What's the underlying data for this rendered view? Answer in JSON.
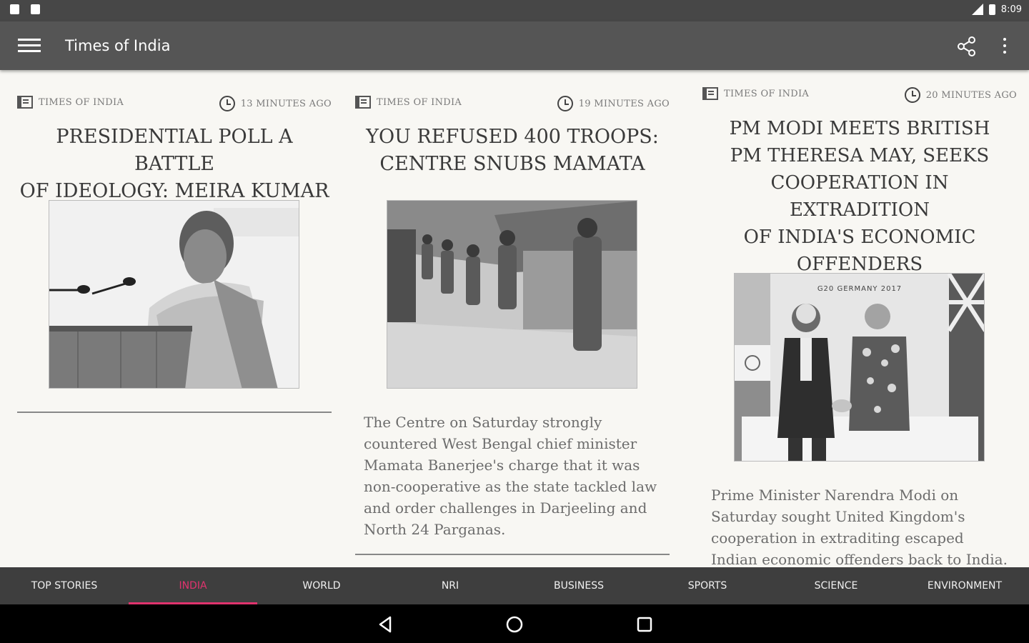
{
  "status_bar": {
    "time": "8:09"
  },
  "app_bar": {
    "title": "Times of India"
  },
  "cards": [
    {
      "source": "TIMES OF INDIA",
      "time": "13 MINUTES AGO",
      "headline_lines": [
        "PRESIDENTIAL POLL A BATTLE",
        "OF IDEOLOGY: MEIRA KUMAR"
      ],
      "summary_lines": []
    },
    {
      "source": "TIMES OF INDIA",
      "time": "19 MINUTES AGO",
      "headline_lines": [
        "YOU REFUSED 400 TROOPS:",
        "CENTRE SNUBS MAMATA"
      ],
      "summary_lines": [
        "The Centre on Saturday strongly",
        "countered West Bengal chief minister",
        "Mamata Banerjee's charge that it was",
        "non-cooperative as the state tackled law",
        "and order challenges in Darjeeling and",
        "North 24 Parganas."
      ]
    },
    {
      "source": "TIMES OF INDIA",
      "time": "20 MINUTES AGO",
      "headline_lines": [
        "PM MODI MEETS BRITISH",
        "PM THERESA MAY, SEEKS",
        "COOPERATION IN EXTRADITION",
        "OF INDIA'S ECONOMIC",
        "OFFENDERS"
      ],
      "image_caption": "G20 GERMANY 2017",
      "summary_lines": [
        "Prime Minister Narendra Modi on",
        "Saturday sought United Kingdom's",
        "cooperation in extraditing escaped",
        "Indian economic offenders back to India."
      ]
    }
  ],
  "tabs": [
    {
      "label": "TOP STORIES",
      "active": false
    },
    {
      "label": "INDIA",
      "active": true
    },
    {
      "label": "WORLD",
      "active": false
    },
    {
      "label": "NRI",
      "active": false
    },
    {
      "label": "BUSINESS",
      "active": false
    },
    {
      "label": "SPORTS",
      "active": false
    },
    {
      "label": "SCIENCE",
      "active": false
    },
    {
      "label": "ENVIRONMENT",
      "active": false
    }
  ],
  "colors": {
    "accent": "#e0336e",
    "app_bar": "#555555",
    "tab_bar": "#3e3e3e"
  },
  "icons": [
    "menu-icon",
    "share-icon",
    "more-vert-icon",
    "newspaper-icon",
    "clock-icon",
    "back-icon",
    "home-icon",
    "recents-icon"
  ]
}
